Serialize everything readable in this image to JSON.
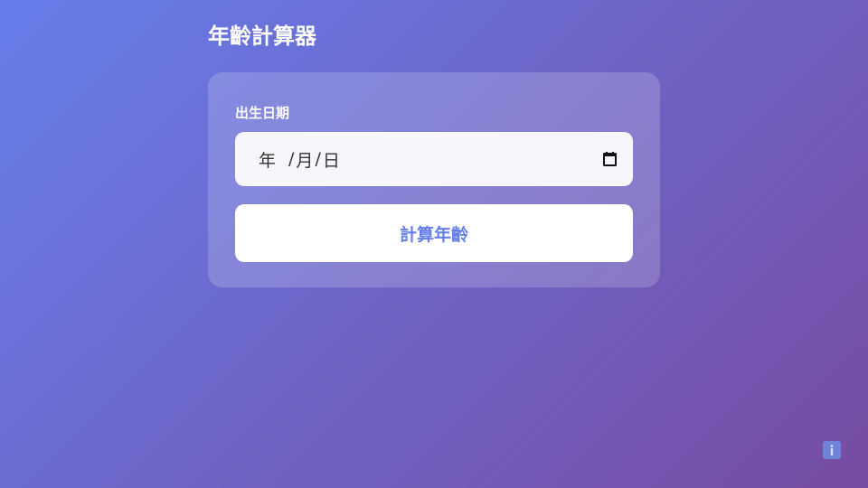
{
  "page": {
    "title": "年齡計算器"
  },
  "form": {
    "birthdate_label": "出生日期",
    "date_input": {
      "year_placeholder": "年",
      "month_placeholder": "月",
      "day_placeholder": "日",
      "separator": "/"
    },
    "submit_label": "計算年齡"
  },
  "icons": {
    "calendar": "calendar-icon",
    "info": "info-icon"
  },
  "colors": {
    "gradient_start": "#667eea",
    "gradient_end": "#764ba2",
    "accent": "#667eea"
  }
}
